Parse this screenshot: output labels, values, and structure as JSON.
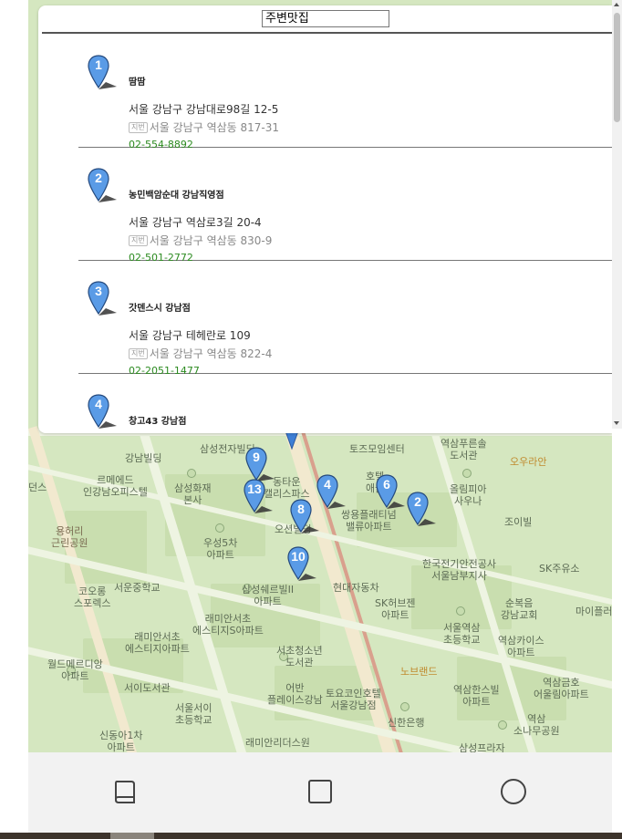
{
  "search": {
    "value": "주변맛집"
  },
  "results": [
    {
      "num": "1",
      "name": "땀땀",
      "road": "서울 강남구 강남대로98길 12-5",
      "jibun_tag": "지번",
      "jibun": "서울 강남구 역삼동 817-31",
      "tel": "02-554-8892"
    },
    {
      "num": "2",
      "name": "농민백암순대 강남직영점",
      "road": "서울 강남구 역삼로3길 20-4",
      "jibun_tag": "지번",
      "jibun": "서울 강남구 역삼동 830-9",
      "tel": "02-501-2772"
    },
    {
      "num": "3",
      "name": "갓덴스시 강남점",
      "road": "서울 강남구 테헤란로 109",
      "jibun_tag": "지번",
      "jibun": "서울 강남구 역삼동 822-4",
      "tel": "02-2051-1477"
    },
    {
      "num": "4",
      "name": "창고43 강남점"
    }
  ],
  "map": {
    "markers": [
      "9",
      "13",
      "8",
      "4",
      "6",
      "2",
      "10"
    ],
    "labels": {
      "l1": "삼성전자빌딩",
      "l2": "토즈모임센터",
      "l3": "역삼푸른솔\n도서관",
      "l4": "오우라안",
      "l5": "강남빌딩",
      "l6": "르메에드\n인강남오피스텔",
      "l7": "삼성화재\n본사",
      "l8": "호텔\n애들",
      "l9": "올림피아\n사우나",
      "l10": "던스",
      "l11": "동타운\n캘리스파스",
      "l12": "쌍용플래티넘\n밸류아파트",
      "l13": "조이빌",
      "l14": "용허리\n근린공원",
      "l15": "우성5차\n아파트",
      "l16": "오션빌딩",
      "l17": "한국전기안전공사\n서울남부지사",
      "l18": "SK주유소",
      "l19": "코오롱\n스포렉스",
      "l20": "서운중학교",
      "l21": "삼성쉐르빌II\n아파트",
      "l22": "현대자동차",
      "l23": "SK허브젠\n아파트",
      "l24": "순복음\n강남교회",
      "l25": "마이플러",
      "l26": "래미안서초\n에스티지아파트",
      "l27": "래미안서초\n에스티지S아파트",
      "l28": "서울역삼\n초등학교",
      "l29": "역삼카이스\n아파트",
      "l30": "서초청소년\n도서관",
      "l31": "노브랜드",
      "l32": "월드메르디앙\n아파트",
      "l33": "서이도서관",
      "l34": "어반\n플레이스강남",
      "l35": "토요코인호텔\n서울강남점",
      "l36": "역삼한스빌\n아파트",
      "l37": "역삼금호\n어울림아파트",
      "l38": "서울서이\n초등학교",
      "l39": "신한은행",
      "l40": "역삼\n소나무공원",
      "l41": "신동아1차\n아파트",
      "l42": "래미안리더스원",
      "l43": "삼성프라자"
    }
  },
  "navigation": {
    "back_icon": "book-icon",
    "home_icon": "square-icon",
    "recent_icon": "circle-icon"
  }
}
